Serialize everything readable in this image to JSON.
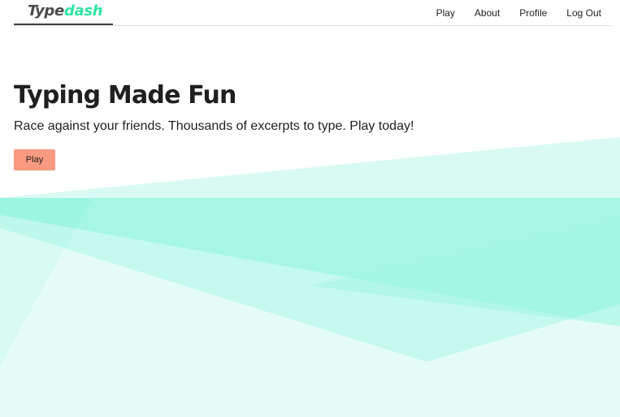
{
  "brand": {
    "name_part1": "Type",
    "name_part2": "dash"
  },
  "nav": {
    "links": [
      "Play",
      "About",
      "Profile",
      "Log Out"
    ]
  },
  "hero": {
    "title": "Typing Made Fun",
    "subtitle": "Race against your friends. Thousands of excerpts to type. Play today!",
    "cta_label": "Play"
  },
  "colors": {
    "brand_accent": "#2ee6a2",
    "cta_background": "#fa9a81",
    "shape_mint": "#7ef3d8"
  }
}
